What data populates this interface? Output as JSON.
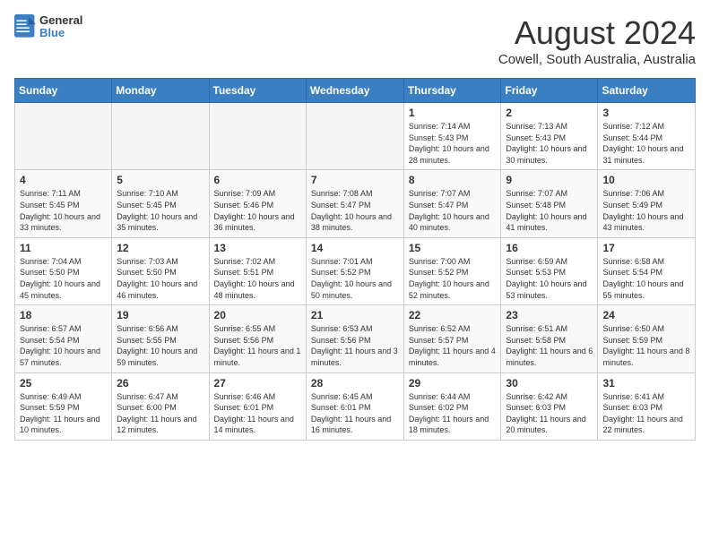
{
  "header": {
    "logo_line1": "General",
    "logo_line2": "Blue",
    "month_title": "August 2024",
    "location": "Cowell, South Australia, Australia"
  },
  "days_of_week": [
    "Sunday",
    "Monday",
    "Tuesday",
    "Wednesday",
    "Thursday",
    "Friday",
    "Saturday"
  ],
  "weeks": [
    [
      {
        "day": "",
        "empty": true
      },
      {
        "day": "",
        "empty": true
      },
      {
        "day": "",
        "empty": true
      },
      {
        "day": "",
        "empty": true
      },
      {
        "day": "1",
        "sunrise": "7:14 AM",
        "sunset": "5:43 PM",
        "daylight": "10 hours and 28 minutes."
      },
      {
        "day": "2",
        "sunrise": "7:13 AM",
        "sunset": "5:43 PM",
        "daylight": "10 hours and 30 minutes."
      },
      {
        "day": "3",
        "sunrise": "7:12 AM",
        "sunset": "5:44 PM",
        "daylight": "10 hours and 31 minutes."
      }
    ],
    [
      {
        "day": "4",
        "sunrise": "7:11 AM",
        "sunset": "5:45 PM",
        "daylight": "10 hours and 33 minutes."
      },
      {
        "day": "5",
        "sunrise": "7:10 AM",
        "sunset": "5:45 PM",
        "daylight": "10 hours and 35 minutes."
      },
      {
        "day": "6",
        "sunrise": "7:09 AM",
        "sunset": "5:46 PM",
        "daylight": "10 hours and 36 minutes."
      },
      {
        "day": "7",
        "sunrise": "7:08 AM",
        "sunset": "5:47 PM",
        "daylight": "10 hours and 38 minutes."
      },
      {
        "day": "8",
        "sunrise": "7:07 AM",
        "sunset": "5:47 PM",
        "daylight": "10 hours and 40 minutes."
      },
      {
        "day": "9",
        "sunrise": "7:07 AM",
        "sunset": "5:48 PM",
        "daylight": "10 hours and 41 minutes."
      },
      {
        "day": "10",
        "sunrise": "7:06 AM",
        "sunset": "5:49 PM",
        "daylight": "10 hours and 43 minutes."
      }
    ],
    [
      {
        "day": "11",
        "sunrise": "7:04 AM",
        "sunset": "5:50 PM",
        "daylight": "10 hours and 45 minutes."
      },
      {
        "day": "12",
        "sunrise": "7:03 AM",
        "sunset": "5:50 PM",
        "daylight": "10 hours and 46 minutes."
      },
      {
        "day": "13",
        "sunrise": "7:02 AM",
        "sunset": "5:51 PM",
        "daylight": "10 hours and 48 minutes."
      },
      {
        "day": "14",
        "sunrise": "7:01 AM",
        "sunset": "5:52 PM",
        "daylight": "10 hours and 50 minutes."
      },
      {
        "day": "15",
        "sunrise": "7:00 AM",
        "sunset": "5:52 PM",
        "daylight": "10 hours and 52 minutes."
      },
      {
        "day": "16",
        "sunrise": "6:59 AM",
        "sunset": "5:53 PM",
        "daylight": "10 hours and 53 minutes."
      },
      {
        "day": "17",
        "sunrise": "6:58 AM",
        "sunset": "5:54 PM",
        "daylight": "10 hours and 55 minutes."
      }
    ],
    [
      {
        "day": "18",
        "sunrise": "6:57 AM",
        "sunset": "5:54 PM",
        "daylight": "10 hours and 57 minutes."
      },
      {
        "day": "19",
        "sunrise": "6:56 AM",
        "sunset": "5:55 PM",
        "daylight": "10 hours and 59 minutes."
      },
      {
        "day": "20",
        "sunrise": "6:55 AM",
        "sunset": "5:56 PM",
        "daylight": "11 hours and 1 minute."
      },
      {
        "day": "21",
        "sunrise": "6:53 AM",
        "sunset": "5:56 PM",
        "daylight": "11 hours and 3 minutes."
      },
      {
        "day": "22",
        "sunrise": "6:52 AM",
        "sunset": "5:57 PM",
        "daylight": "11 hours and 4 minutes."
      },
      {
        "day": "23",
        "sunrise": "6:51 AM",
        "sunset": "5:58 PM",
        "daylight": "11 hours and 6 minutes."
      },
      {
        "day": "24",
        "sunrise": "6:50 AM",
        "sunset": "5:59 PM",
        "daylight": "11 hours and 8 minutes."
      }
    ],
    [
      {
        "day": "25",
        "sunrise": "6:49 AM",
        "sunset": "5:59 PM",
        "daylight": "11 hours and 10 minutes."
      },
      {
        "day": "26",
        "sunrise": "6:47 AM",
        "sunset": "6:00 PM",
        "daylight": "11 hours and 12 minutes."
      },
      {
        "day": "27",
        "sunrise": "6:46 AM",
        "sunset": "6:01 PM",
        "daylight": "11 hours and 14 minutes."
      },
      {
        "day": "28",
        "sunrise": "6:45 AM",
        "sunset": "6:01 PM",
        "daylight": "11 hours and 16 minutes."
      },
      {
        "day": "29",
        "sunrise": "6:44 AM",
        "sunset": "6:02 PM",
        "daylight": "11 hours and 18 minutes."
      },
      {
        "day": "30",
        "sunrise": "6:42 AM",
        "sunset": "6:03 PM",
        "daylight": "11 hours and 20 minutes."
      },
      {
        "day": "31",
        "sunrise": "6:41 AM",
        "sunset": "6:03 PM",
        "daylight": "11 hours and 22 minutes."
      }
    ]
  ]
}
